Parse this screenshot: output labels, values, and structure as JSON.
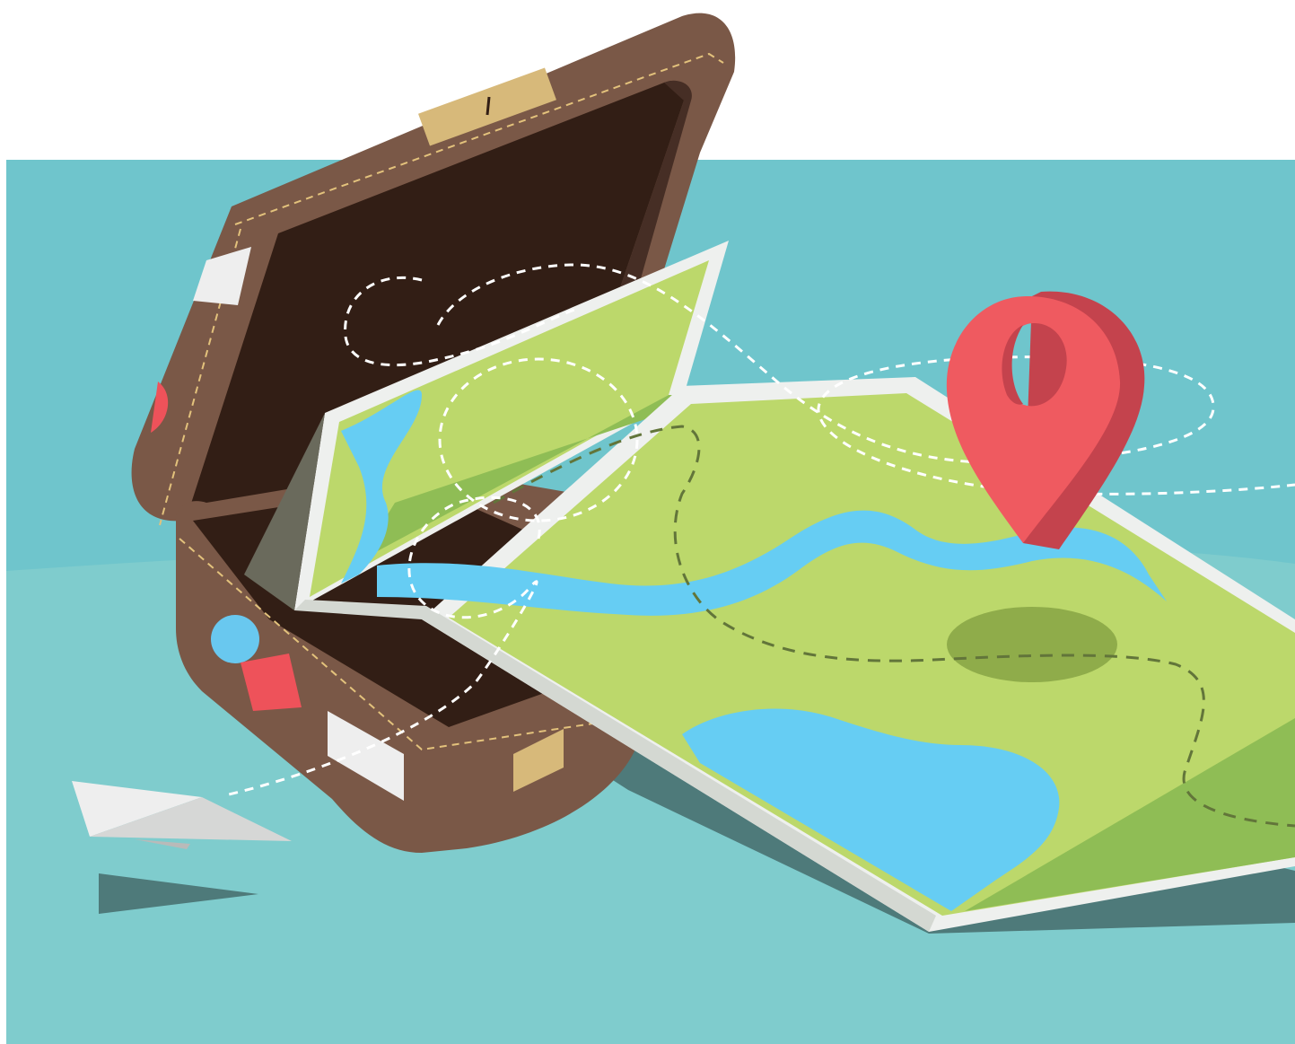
{
  "scene": {
    "subject": "illustration",
    "colors": {
      "page_background": "#ffffff",
      "sky_band": "#6fc5cc",
      "ground": "#7fcccd",
      "shadow": "#4e7a7a",
      "suitcase_body": "#7a5847",
      "suitcase_dark_edge": "#5e4034",
      "suitcase_interior": "#321e15",
      "suitcase_lid_shade": "#462e25",
      "stitching": "#e3c27c",
      "latch": "#d7b97a",
      "map_land_light": "#bcd86b",
      "map_land_dark": "#8fbd55",
      "map_water": "#66cdf3",
      "map_border": "#eef0ee",
      "map_border_shade": "#d4d8d2",
      "map_route": "#62753a",
      "flight_path": "#ffffff",
      "pin_front": "#ef5a60",
      "pin_side": "#c4434d",
      "sticker_red": "#ee525a",
      "sticker_blue": "#69c8ef",
      "sticker_white": "#eeeeee",
      "paper_plane": "#eeeeee",
      "paper_plane_shade": "#d6d7d6"
    },
    "icons": [
      "map-pin-icon",
      "paper-plane-icon",
      "suitcase-icon",
      "map-icon"
    ]
  }
}
